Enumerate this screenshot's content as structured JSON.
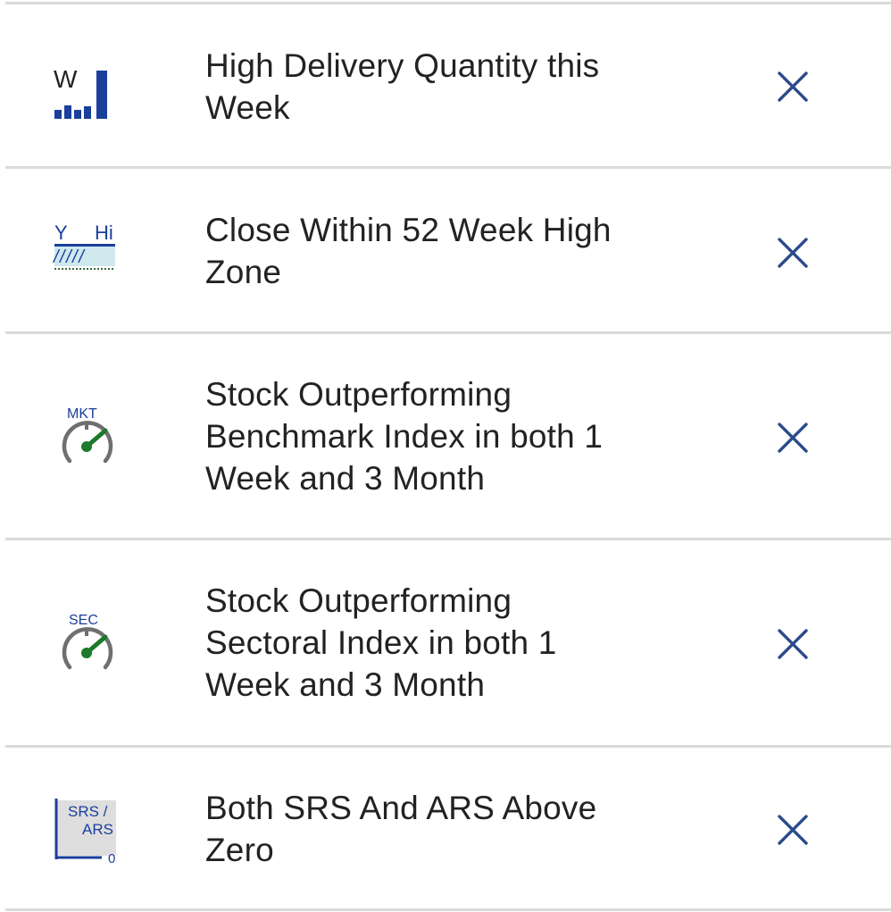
{
  "screener_list": {
    "items": [
      {
        "label_lines": [
          "High Delivery Quantity this",
          "Week"
        ],
        "icon": "weekly-delivery-bars-icon",
        "icon_text": "W",
        "action": "remove-icon"
      },
      {
        "label_lines": [
          "Close Within 52 Week High",
          "Zone"
        ],
        "icon": "year-high-zone-icon",
        "icon_text_left": "Y",
        "icon_text_right": "Hi",
        "icon_hatch": "/////",
        "action": "remove-icon"
      },
      {
        "label_lines": [
          "Stock Outperforming",
          "Benchmark Index in both 1",
          "Week and 3 Month"
        ],
        "icon": "market-speedometer-icon",
        "icon_text": "MKT",
        "action": "remove-icon"
      },
      {
        "label_lines": [
          "Stock Outperforming",
          "Sectoral Index in both 1",
          "Week and 3 Month"
        ],
        "icon": "sector-speedometer-icon",
        "icon_text": "SEC",
        "action": "remove-icon"
      },
      {
        "label_lines": [
          "Both SRS And ARS Above",
          "Zero"
        ],
        "icon": "srs-ars-zero-icon",
        "icon_text_top": "SRS /",
        "icon_text_bottom": "ARS",
        "icon_text_zero": "0",
        "action": "remove-icon"
      }
    ]
  },
  "colors": {
    "icon_blue": "#1a3f9c",
    "gauge_green": "#1d7a2a",
    "gauge_gray": "#6f6f6f",
    "close_x": "#2b4a8c",
    "divider": "#dadada",
    "text": "#222222"
  }
}
